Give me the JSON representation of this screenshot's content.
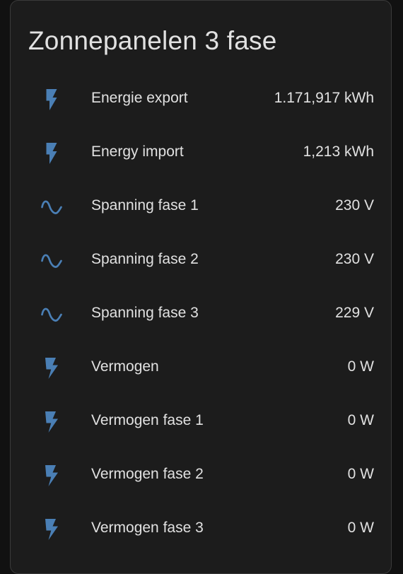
{
  "card": {
    "title": "Zonnepanelen 3 fase"
  },
  "colors": {
    "icon": "#4a7fb5",
    "background": "#111111",
    "card": "#1c1c1c",
    "text": "#e1e1e1"
  },
  "entities": [
    {
      "name": "Energie export",
      "state": "1.171,917 kWh",
      "icon": "flash-icon"
    },
    {
      "name": "Energy import",
      "state": "1,213 kWh",
      "icon": "flash-icon"
    },
    {
      "name": "Spanning fase 1",
      "state": "230 V",
      "icon": "sine-wave-icon"
    },
    {
      "name": "Spanning fase 2",
      "state": "230 V",
      "icon": "sine-wave-icon"
    },
    {
      "name": "Spanning fase 3",
      "state": "229 V",
      "icon": "sine-wave-icon"
    },
    {
      "name": "Vermogen",
      "state": "0 W",
      "icon": "power-bolt-icon"
    },
    {
      "name": "Vermogen fase 1",
      "state": "0 W",
      "icon": "power-bolt-icon"
    },
    {
      "name": "Vermogen fase 2",
      "state": "0 W",
      "icon": "power-bolt-icon"
    },
    {
      "name": "Vermogen fase 3",
      "state": "0 W",
      "icon": "power-bolt-icon"
    }
  ]
}
